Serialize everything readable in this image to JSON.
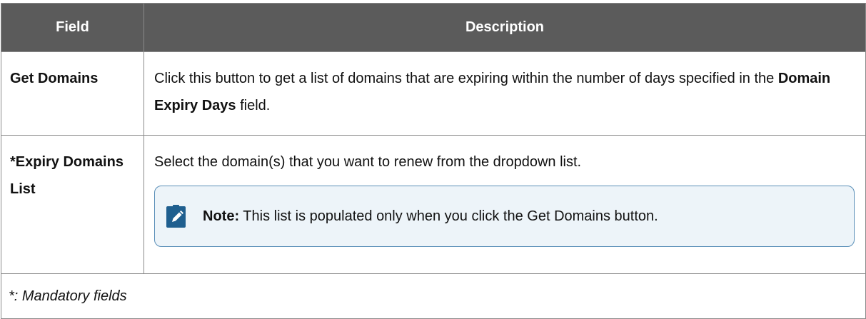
{
  "table": {
    "headers": [
      "Field",
      "Description"
    ],
    "rows": [
      {
        "field": "Get Domains",
        "description_before": "Click this button to get a list of domains that are expiring within the number of days specified in the ",
        "description_bold": "Domain Expiry Days",
        "description_after": " field."
      },
      {
        "field": "*Expiry Domains List",
        "description": "Select the domain(s) that you want to renew from the dropdown list.",
        "note": {
          "label": "Note:",
          "text": " This list is populated only when you click the Get Domains button.",
          "icon": "pencil-note-icon",
          "border_color": "#5a8fb8",
          "background_color": "#edf4f9"
        }
      }
    ],
    "footer": "*: Mandatory fields",
    "header_background": "#5b5b5b"
  }
}
